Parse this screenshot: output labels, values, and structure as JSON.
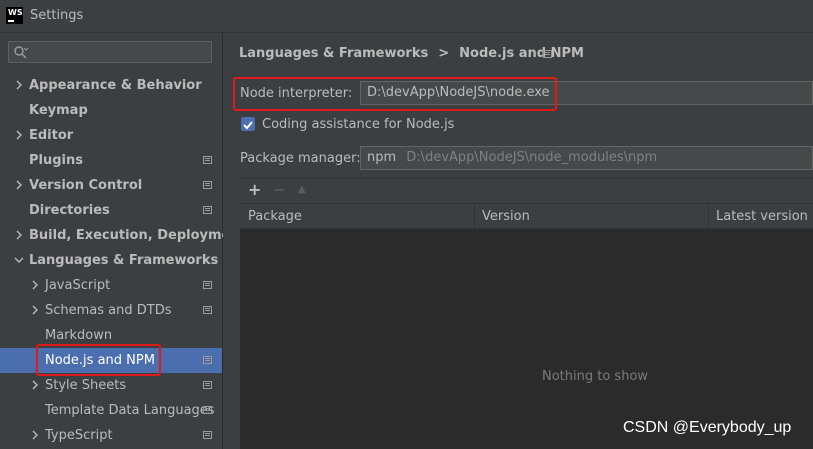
{
  "window": {
    "title": "Settings",
    "app_icon_text": "WS"
  },
  "search": {
    "placeholder": ""
  },
  "tree": [
    {
      "label": "Appearance & Behavior",
      "bold": true,
      "expandable": true,
      "expanded": false,
      "level": 0,
      "project_icon": false
    },
    {
      "label": "Keymap",
      "bold": true,
      "expandable": false,
      "level": 0,
      "project_icon": false
    },
    {
      "label": "Editor",
      "bold": true,
      "expandable": true,
      "expanded": false,
      "level": 0,
      "project_icon": false
    },
    {
      "label": "Plugins",
      "bold": true,
      "expandable": false,
      "level": 0,
      "project_icon": true
    },
    {
      "label": "Version Control",
      "bold": true,
      "expandable": true,
      "expanded": false,
      "level": 0,
      "project_icon": true
    },
    {
      "label": "Directories",
      "bold": true,
      "expandable": false,
      "level": 0,
      "project_icon": true
    },
    {
      "label": "Build, Execution, Deployment",
      "bold": true,
      "expandable": true,
      "expanded": false,
      "level": 0,
      "project_icon": false
    },
    {
      "label": "Languages & Frameworks",
      "bold": true,
      "expandable": true,
      "expanded": true,
      "level": 0,
      "project_icon": false
    },
    {
      "label": "JavaScript",
      "bold": false,
      "expandable": true,
      "expanded": false,
      "level": 1,
      "project_icon": true
    },
    {
      "label": "Schemas and DTDs",
      "bold": false,
      "expandable": true,
      "expanded": false,
      "level": 1,
      "project_icon": true
    },
    {
      "label": "Markdown",
      "bold": false,
      "expandable": false,
      "level": 1,
      "project_icon": false
    },
    {
      "label": "Node.js and NPM",
      "bold": false,
      "expandable": false,
      "level": 1,
      "project_icon": true,
      "selected": true
    },
    {
      "label": "Style Sheets",
      "bold": false,
      "expandable": true,
      "expanded": false,
      "level": 1,
      "project_icon": true
    },
    {
      "label": "Template Data Languages",
      "bold": false,
      "expandable": false,
      "level": 1,
      "project_icon": true
    },
    {
      "label": "TypeScript",
      "bold": false,
      "expandable": true,
      "expanded": false,
      "level": 1,
      "project_icon": true
    }
  ],
  "breadcrumb": {
    "parent": "Languages & Frameworks",
    "separator": ">",
    "current": "Node.js and NPM"
  },
  "node_interpreter": {
    "label": "Node interpreter:",
    "value": "D:\\devApp\\NodeJS\\node.exe"
  },
  "coding_assistance": {
    "label": "Coding assistance for Node.js",
    "checked": true
  },
  "package_manager": {
    "label": "Package manager:",
    "name": "npm",
    "path": "D:\\devApp\\NodeJS\\node_modules\\npm"
  },
  "toolbar": {
    "add": "+",
    "remove": "−",
    "upgrade": "▲"
  },
  "table": {
    "columns": [
      "Package",
      "Version",
      "Latest version"
    ],
    "empty_text": "Nothing to show"
  },
  "watermark": "CSDN @Everybody_up",
  "colors": {
    "selection": "#4b6eaf",
    "highlight_box": "#e0191b",
    "background": "#3c3f41"
  }
}
